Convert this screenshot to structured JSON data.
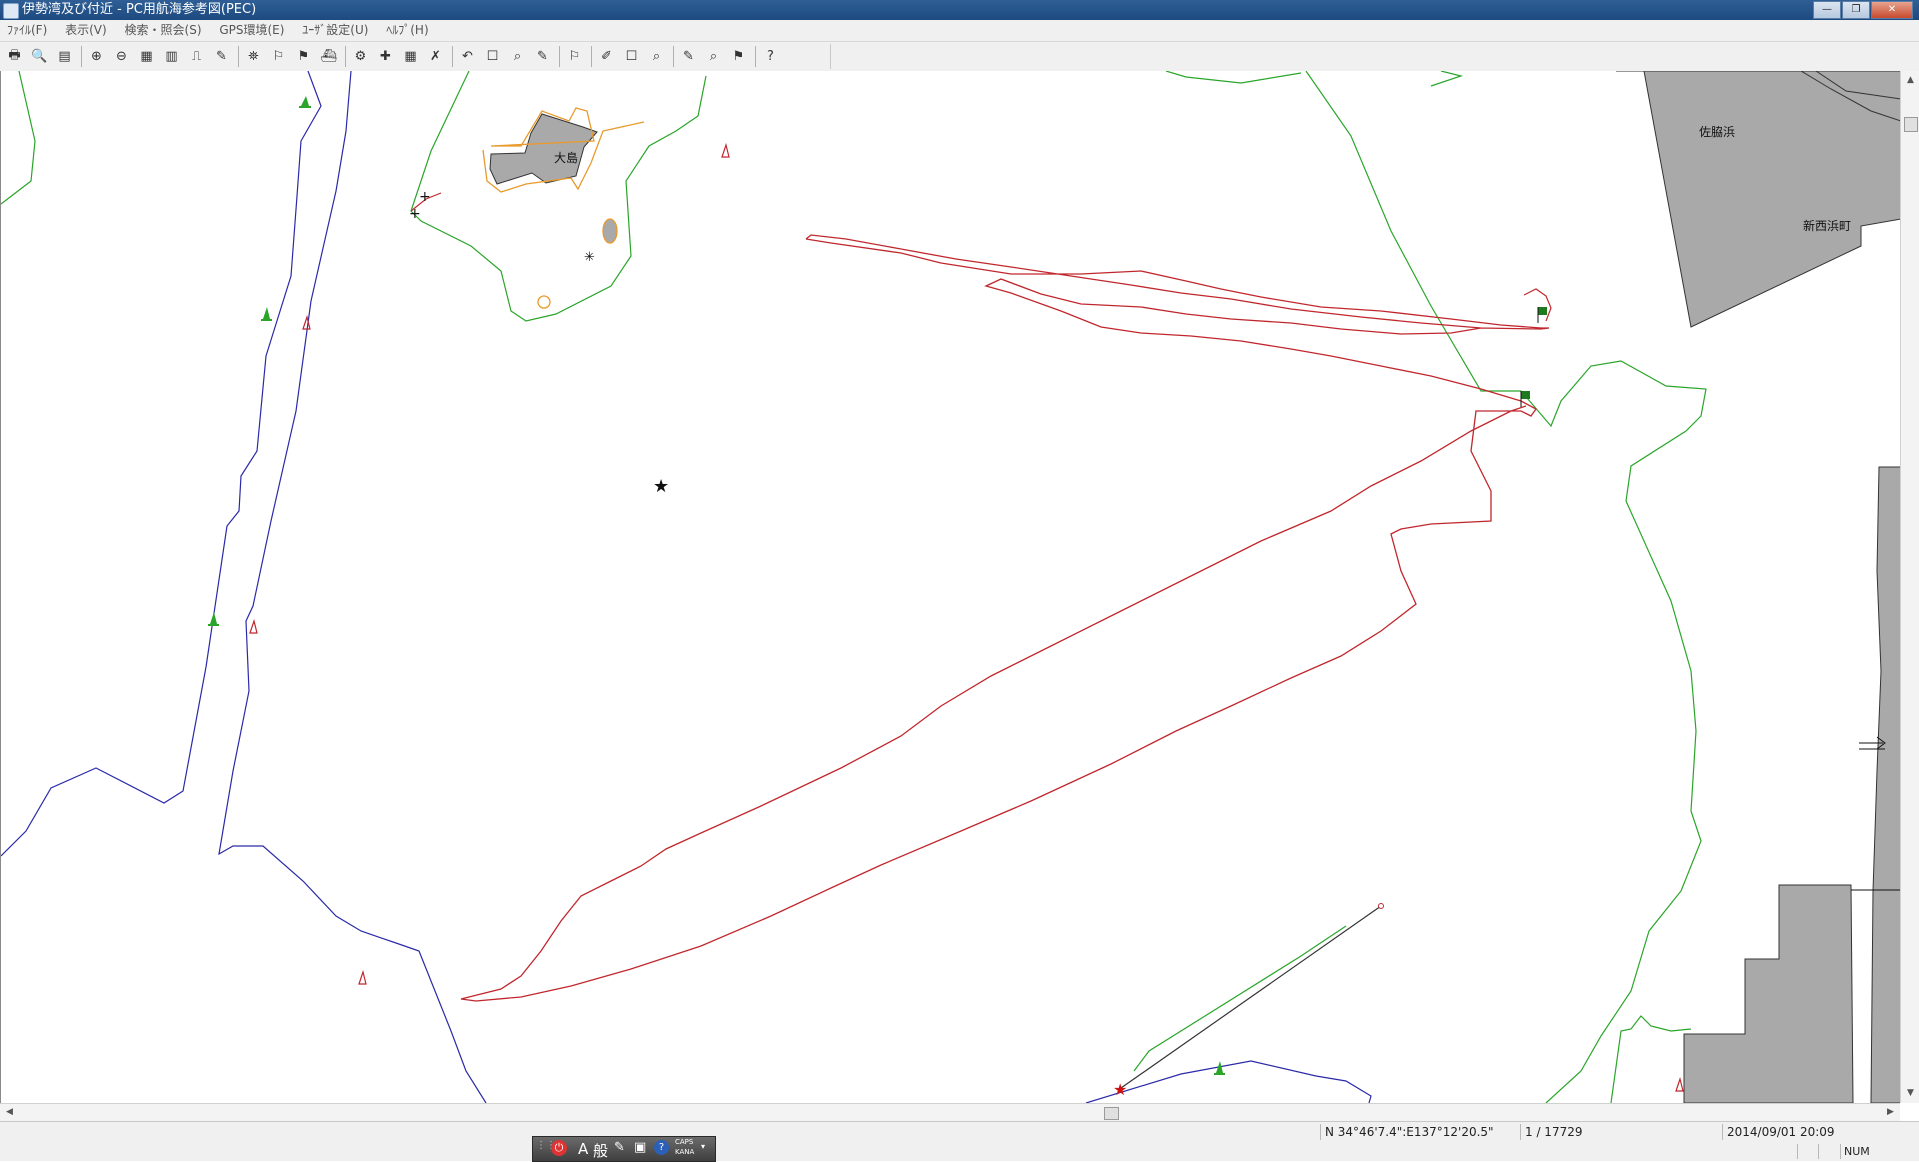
{
  "window": {
    "title": "伊勢湾及び付近 - PC用航海参考図(PEC)"
  },
  "window_controls": [
    "—",
    "❐",
    "✕"
  ],
  "menu": [
    "ﾌｧｲﾙ(F)",
    "表示(V)",
    "検索・照会(S)",
    "GPS環境(E)",
    "ﾕｰｻﾞ設定(U)",
    "ﾍﾙﾌﾟ(H)"
  ],
  "toolbar": {
    "glyphs": [
      "🖶",
      "🔍",
      "▤",
      "⊕",
      "⊖",
      "▦",
      "▥",
      "⎍",
      "✎",
      "⛯",
      "⚐",
      "⚑",
      "⛴",
      "⚙",
      "✚",
      "▦",
      "✗",
      "↶",
      "☐",
      "⌕",
      "✎",
      "⚐",
      "✐",
      "☐",
      "⌕",
      "✎",
      "⌕",
      "⚑",
      "?"
    ]
  },
  "map": {
    "labels": {
      "oshima": "大島",
      "sawahama": "佐脇浜",
      "shinsaihama": "新西浜町"
    },
    "colors": {
      "track": "#c0272d",
      "route_blue": "#2a2aa8",
      "depth_green": "#2aa52a",
      "land": "#a9a9a9",
      "shore_orange": "#e89a2c"
    }
  },
  "scrollbars": {
    "up": "▲",
    "down": "▼",
    "left": "◀",
    "right": "▶"
  },
  "status": {
    "coordinates": "N 34°46'7.4\":E137°12'20.5\"",
    "scale": "1 / 17729",
    "datetime": "2014/09/01 20:09",
    "num": "NUM"
  },
  "ime": {
    "mode": "A",
    "kanji": "般",
    "caps": "CAPS",
    "kana": "KANA"
  }
}
